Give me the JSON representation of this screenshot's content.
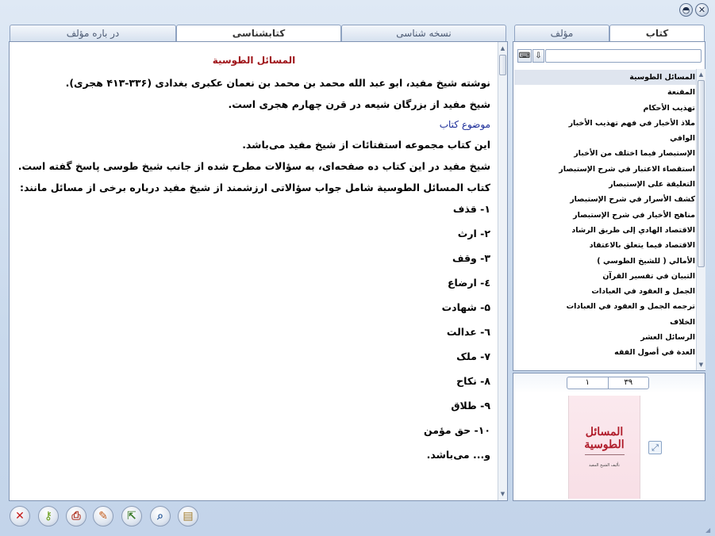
{
  "window": {
    "minimize_glyph": "◓",
    "close_glyph": "✕"
  },
  "left_tabs": [
    {
      "label": "در باره مؤلف"
    },
    {
      "label": "کتابشناسی"
    },
    {
      "label": "نسخه شناسی"
    }
  ],
  "right_tabs": [
    {
      "label": "مؤلف"
    },
    {
      "label": "کتاب"
    }
  ],
  "article": {
    "title": "المسائل الطوسية",
    "para1": "نوشته شیخ مفید، ابو عبد الله محمد بن محمد بن نعمان عکبری بغدادی (۳۳۶-۴۱۳ هجری).",
    "para2": "شیخ مفید از بزرگان شیعه در قرن چهارم هجری است.",
    "section_heading": "موضوع کتاب",
    "para3": "این کتاب مجموعه استفتائات از شیخ مفید می‌باشد.",
    "para4": "شیخ مفید در این کتاب ده صفحه‌ای، به سؤالات مطرح شده از جانب شیخ طوسی پاسخ گفته است.",
    "para5": "کتاب المسائل الطوسية شامل جواب سؤالاتی ارزشمند از شیخ مفید درباره برخی از مسائل مانند:",
    "items": [
      "۱- قذف",
      "۲- ارث",
      "۳- وقف",
      "٤- ارضاع",
      "۵- شهادت",
      "٦- عدالت",
      "۷- ملک",
      "۸- نکاح",
      "۹- طلاق",
      "۱۰- حق مؤمن",
      "و... می‌باشد."
    ]
  },
  "search": {
    "value": "",
    "keyboard_icon": "keyboard-icon",
    "down_icon": "arrow-down-icon"
  },
  "books": [
    "المسائل الطوسية",
    "المقنعة",
    "تهذيب الأحكام",
    "ملاذ الأخيار في فهم تهذيب الأخبار",
    "الوافي",
    "الإستبصار فيما اختلف من الأخبار",
    "استقصاء الاعتبار في شرح الإستبصار",
    "التعليقة على الإستبصار",
    "كشف الأسرار في شرح الإستبصار",
    "مناهج الأخيار في شرح الإستبصار",
    "الاقتصاد الهادي إلى طريق الرشاد",
    "الاقتصاد فيما يتعلق بالاعتقاد",
    "الأمالي ( للشيخ الطوسي )",
    "التبيان في تفسير القرآن",
    "الجمل و العقود في العبادات",
    "ترجمه الجمل و العقود في العبادات",
    "الخلاف",
    "الرسائل العشر",
    "العدة في أصول الفقه"
  ],
  "pager": {
    "current": "۱",
    "total": "۳۹"
  },
  "cover": {
    "title": "المسائل الطوسية",
    "subtitle": "تأليف الشيخ المفيد"
  },
  "toolbar": {
    "close": "✕",
    "key": "⚷",
    "print": "⎙",
    "edit": "✎",
    "export": "⇱",
    "search": "⌕",
    "note": "▤"
  }
}
